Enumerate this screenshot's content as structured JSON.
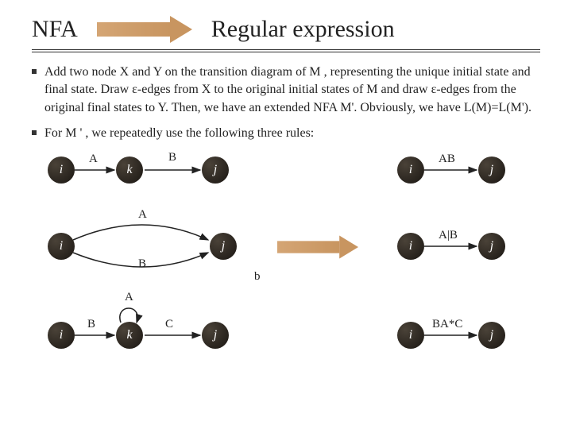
{
  "header": {
    "left": "NFA",
    "right": "Regular expression"
  },
  "bullets": [
    "Add two node X and Y on the transition diagram of M ,  representing the unique initial state and final state. Draw ε-edges from X to the original initial states of M and draw ε-edges from the original final states to Y. Then, we have an extended NFA M'. Obviously, we have L(M)=L(M').",
    "For M ' , we repeatedly use  the following three rules:"
  ],
  "diagram": {
    "rule1": {
      "left_i": "i",
      "mid_k": "k",
      "right_j": "j",
      "labelA": "A",
      "labelB": "B",
      "out_i": "i",
      "out_j": "j",
      "out_label": "AB"
    },
    "rule2": {
      "left_i": "i",
      "right_j": "j",
      "labelA": "A",
      "labelB": "B",
      "out_i": "i",
      "out_j": "j",
      "out_label": "A|B",
      "extra_b": "b"
    },
    "rule3": {
      "left_i": "i",
      "mid_k": "k",
      "right_j": "j",
      "labelB": "B",
      "labelA": "A",
      "labelC": "C",
      "out_i": "i",
      "out_j": "j",
      "out_label": "BA*C"
    }
  }
}
